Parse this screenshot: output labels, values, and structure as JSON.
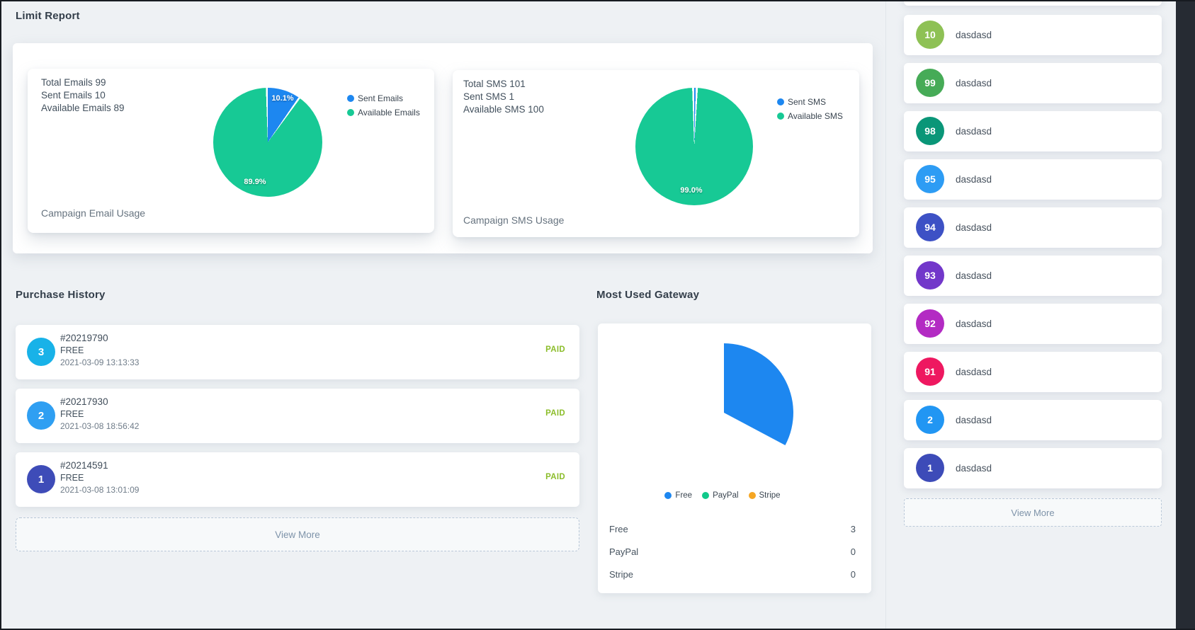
{
  "colors": {
    "chart_blue": "#1d87f0",
    "chart_green": "#17c995",
    "paypal_green": "#10c98a",
    "stripe_orange": "#f5a623",
    "paid_green": "#8cbd2b",
    "page_bg": "#eef1f4",
    "dark_strip": "#262b33"
  },
  "limit_report": {
    "title": "Limit Report",
    "email": {
      "stats": [
        "Total Emails 99",
        "Sent Emails 10",
        "Available Emails 89"
      ],
      "chart_title": "Campaign Email Usage",
      "slice_labels": {
        "sent_pct": "10.1%",
        "available_pct": "89.9%"
      },
      "legend": [
        {
          "label": "Sent Emails",
          "color": "#1d87f0"
        },
        {
          "label": "Available Emails",
          "color": "#17c995"
        }
      ]
    },
    "sms": {
      "stats": [
        "Total SMS 101",
        "Sent SMS 1",
        "Available SMS 100"
      ],
      "chart_title": "Campaign SMS Usage",
      "slice_labels": {
        "available_pct": "99.0%"
      },
      "legend": [
        {
          "label": "Sent SMS",
          "color": "#1d87f0"
        },
        {
          "label": "Available SMS",
          "color": "#17c995"
        }
      ]
    }
  },
  "purchase_history": {
    "title": "Purchase History",
    "items": [
      {
        "num": "3",
        "color": "#18b2e8",
        "order": "#20219790",
        "plan": "FREE",
        "date": "2021-03-09 13:13:33",
        "status": "PAID"
      },
      {
        "num": "2",
        "color": "#2f9ff2",
        "order": "#20217930",
        "plan": "FREE",
        "date": "2021-03-08 18:56:42",
        "status": "PAID"
      },
      {
        "num": "1",
        "color": "#3e4cb8",
        "order": "#20214591",
        "plan": "FREE",
        "date": "2021-03-08 13:01:09",
        "status": "PAID"
      }
    ],
    "view_more": "View More"
  },
  "gateway": {
    "title": "Most Used Gateway",
    "legend": [
      {
        "label": "Free",
        "color": "#1d87f0"
      },
      {
        "label": "PayPal",
        "color": "#10c98a"
      },
      {
        "label": "Stripe",
        "color": "#f5a623"
      }
    ],
    "rows": [
      {
        "label": "Free",
        "value": "3"
      },
      {
        "label": "PayPal",
        "value": "0"
      },
      {
        "label": "Stripe",
        "value": "0"
      }
    ]
  },
  "sidebar": {
    "items": [
      {
        "num": "10",
        "color": "#8ec155",
        "label": "dasdasd"
      },
      {
        "num": "99",
        "color": "#46ab57",
        "label": "dasdasd"
      },
      {
        "num": "98",
        "color": "#0a9678",
        "label": "dasdasd"
      },
      {
        "num": "95",
        "color": "#2d9cf4",
        "label": "dasdasd"
      },
      {
        "num": "94",
        "color": "#3d51c5",
        "label": "dasdasd"
      },
      {
        "num": "93",
        "color": "#7237ca",
        "label": "dasdasd"
      },
      {
        "num": "92",
        "color": "#b32bc3",
        "label": "dasdasd"
      },
      {
        "num": "91",
        "color": "#ee1860",
        "label": "dasdasd"
      },
      {
        "num": "2",
        "color": "#2196f3",
        "label": "dasdasd"
      },
      {
        "num": "1",
        "color": "#3d4bb8",
        "label": "dasdasd"
      }
    ],
    "view_more": "View More"
  },
  "chart_data": [
    {
      "type": "pie",
      "title": "Campaign Email Usage",
      "labels": [
        "Sent Emails",
        "Available Emails"
      ],
      "values": [
        10,
        89
      ],
      "pct_labels": [
        "10.1%",
        "89.9%"
      ],
      "colors": [
        "#1d87f0",
        "#17c995"
      ],
      "legend_position": "right"
    },
    {
      "type": "pie",
      "title": "Campaign SMS Usage",
      "labels": [
        "Sent SMS",
        "Available SMS"
      ],
      "values": [
        1,
        100
      ],
      "pct_labels": [
        "",
        "99.0%"
      ],
      "colors": [
        "#1d87f0",
        "#17c995"
      ],
      "legend_position": "right"
    },
    {
      "type": "pie",
      "title": "Most Used Gateway",
      "labels": [
        "Free",
        "PayPal",
        "Stripe"
      ],
      "values": [
        3,
        0,
        0
      ],
      "colors": [
        "#1d87f0",
        "#10c98a",
        "#f5a623"
      ],
      "legend_position": "bottom",
      "sweep_deg": 118
    }
  ]
}
